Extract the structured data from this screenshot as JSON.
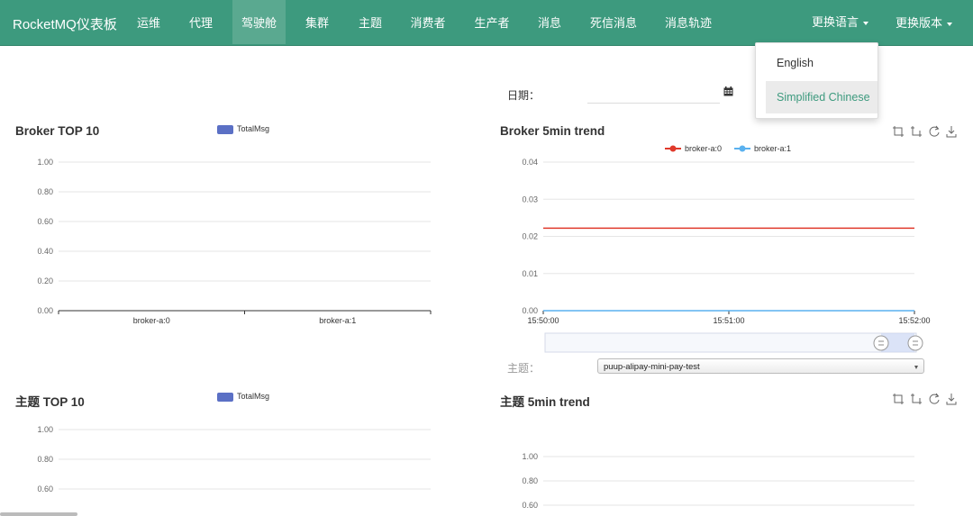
{
  "brand": "RocketMQ仪表板",
  "nav": [
    {
      "label": "运维",
      "active": false
    },
    {
      "label": "代理",
      "active": false
    },
    {
      "label": "驾驶舱",
      "active": true
    },
    {
      "label": "集群",
      "active": false
    },
    {
      "label": "主题",
      "active": false
    },
    {
      "label": "消费者",
      "active": false
    },
    {
      "label": "生产者",
      "active": false
    },
    {
      "label": "消息",
      "active": false
    },
    {
      "label": "死信消息",
      "active": false
    },
    {
      "label": "消息轨迹",
      "active": false
    }
  ],
  "nav_right": {
    "language": "更换语言",
    "version": "更换版本"
  },
  "language_menu": {
    "items": [
      "English",
      "Simplified Chinese"
    ],
    "selected": "Simplified Chinese"
  },
  "filter": {
    "date_label": "日期：",
    "date_value": ""
  },
  "topic_filter": {
    "label": "主题：",
    "selected": "puup-alipay-mini-pay-test"
  },
  "toolbox_icons": [
    "zoom-icon",
    "zoom-reset-icon",
    "refresh-icon",
    "download-icon"
  ],
  "colors": {
    "navbar": "#3d9a7e",
    "bar_series": "#5b70c5",
    "broker_a0": "#e0392b",
    "broker_a1": "#5ab1ef"
  },
  "chart_data": [
    {
      "type": "bar",
      "title": "Broker TOP 10",
      "categories": [
        "broker-a:0",
        "broker-a:1"
      ],
      "series": [
        {
          "name": "TotalMsg",
          "values": [
            0,
            0
          ]
        }
      ],
      "ylim": [
        0,
        1
      ],
      "yticks": [
        "1.00",
        "0.80",
        "0.60",
        "0.40",
        "0.20",
        "0.00"
      ],
      "legend": "top-center"
    },
    {
      "type": "line",
      "title": "Broker 5min trend",
      "x": [
        "15:50:00",
        "15:51:00",
        "15:52:00"
      ],
      "series": [
        {
          "name": "broker-a:0",
          "values": [
            0.0222,
            0.0222,
            0.0222
          ]
        },
        {
          "name": "broker-a:1",
          "values": [
            0,
            0,
            0
          ]
        }
      ],
      "ylim": [
        0,
        0.04
      ],
      "yticks": [
        "0.04",
        "0.03",
        "0.02",
        "0.01",
        "0.00"
      ],
      "legend": "top-center",
      "datazoom": true
    },
    {
      "type": "bar",
      "title": "主题 TOP 10",
      "categories": [],
      "series": [
        {
          "name": "TotalMsg",
          "values": []
        }
      ],
      "ylim": [
        0,
        1
      ],
      "yticks": [
        "1.00",
        "0.80",
        "0.60"
      ],
      "legend": "top-center"
    },
    {
      "type": "line",
      "title": "主题 5min trend",
      "x": [],
      "series": [],
      "ylim": [
        0,
        1
      ],
      "yticks": [
        "1.00",
        "0.80",
        "0.60"
      ]
    }
  ]
}
